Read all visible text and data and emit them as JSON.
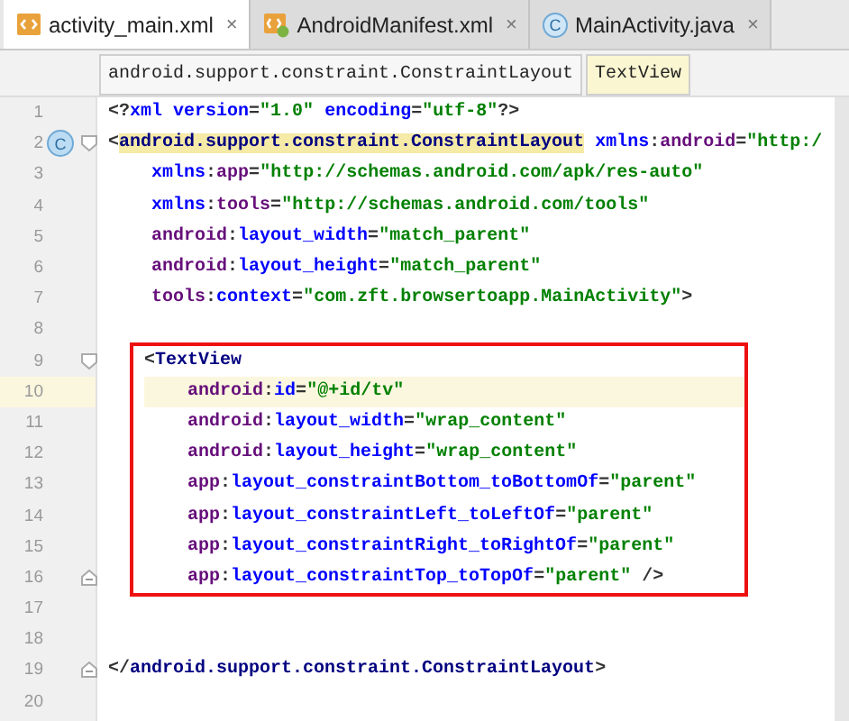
{
  "tabs": [
    {
      "label": "activity_main.xml",
      "kind": "xml",
      "selected": true,
      "close": "×"
    },
    {
      "label": "AndroidManifest.xml",
      "kind": "manifest",
      "selected": false,
      "close": "×"
    },
    {
      "label": "MainActivity.java",
      "kind": "class",
      "icon_text": "C",
      "selected": false,
      "close": "×"
    }
  ],
  "breadcrumbs": [
    {
      "label": "android.support.constraint.ConstraintLayout",
      "selected": false
    },
    {
      "label": "TextView",
      "selected": true
    }
  ],
  "line_groups": [
    {
      "boxed": false,
      "lines": [
        {
          "number": "1",
          "current": false,
          "kind": "plain",
          "tokens": [
            {
              "kind": "punct",
              "text": "<?"
            },
            {
              "kind": "attr",
              "text": "xml version"
            },
            {
              "kind": "punct",
              "text": "="
            },
            {
              "kind": "value",
              "text": "\"1.0\""
            },
            {
              "kind": "attr",
              "text": " encoding"
            },
            {
              "kind": "punct",
              "text": "="
            },
            {
              "kind": "value",
              "text": "\"utf-8\""
            },
            {
              "kind": "punct",
              "text": "?>"
            }
          ]
        },
        {
          "number": "2",
          "current": false,
          "kind": "fold-start",
          "gutter_badge": "C",
          "tokens": [
            {
              "kind": "punct",
              "text": "<"
            },
            {
              "kind": "tag-match",
              "text": "android.support.constraint.ConstraintLayout"
            },
            {
              "kind": "attr",
              "text": " xmlns"
            },
            {
              "kind": "punct",
              "text": ":"
            },
            {
              "kind": "ns",
              "text": "android"
            },
            {
              "kind": "punct",
              "text": "="
            },
            {
              "kind": "value",
              "text": "\"http:/"
            }
          ]
        },
        {
          "number": "3",
          "current": false,
          "kind": "plain",
          "tokens": [
            {
              "kind": "attr",
              "text": "    xmlns"
            },
            {
              "kind": "punct",
              "text": ":"
            },
            {
              "kind": "ns",
              "text": "app"
            },
            {
              "kind": "punct",
              "text": "="
            },
            {
              "kind": "value",
              "text": "\"http://schemas.android.com/apk/res-auto\""
            }
          ]
        },
        {
          "number": "4",
          "current": false,
          "kind": "plain",
          "tokens": [
            {
              "kind": "attr",
              "text": "    xmlns"
            },
            {
              "kind": "punct",
              "text": ":"
            },
            {
              "kind": "ns",
              "text": "tools"
            },
            {
              "kind": "punct",
              "text": "="
            },
            {
              "kind": "value",
              "text": "\"http://schemas.android.com/tools\""
            }
          ]
        },
        {
          "number": "5",
          "current": false,
          "kind": "plain",
          "tokens": [
            {
              "kind": "ns",
              "text": "    android"
            },
            {
              "kind": "punct",
              "text": ":"
            },
            {
              "kind": "attr",
              "text": "layout_width"
            },
            {
              "kind": "punct",
              "text": "="
            },
            {
              "kind": "value",
              "text": "\"match_parent\""
            }
          ]
        },
        {
          "number": "6",
          "current": false,
          "kind": "plain",
          "tokens": [
            {
              "kind": "ns",
              "text": "    android"
            },
            {
              "kind": "punct",
              "text": ":"
            },
            {
              "kind": "attr",
              "text": "layout_height"
            },
            {
              "kind": "punct",
              "text": "="
            },
            {
              "kind": "value",
              "text": "\"match_parent\""
            }
          ]
        },
        {
          "number": "7",
          "current": false,
          "kind": "plain",
          "tokens": [
            {
              "kind": "ns",
              "text": "    tools"
            },
            {
              "kind": "punct",
              "text": ":"
            },
            {
              "kind": "attr",
              "text": "context"
            },
            {
              "kind": "punct",
              "text": "="
            },
            {
              "kind": "value",
              "text": "\"com.zft.browsertoapp.MainActivity\""
            },
            {
              "kind": "punct",
              "text": ">"
            }
          ]
        },
        {
          "number": "8",
          "current": false,
          "kind": "plain"
        }
      ]
    },
    {
      "boxed": true,
      "lines": [
        {
          "number": "9",
          "current": false,
          "kind": "fold-start",
          "tokens": [
            {
              "kind": "punct",
              "text": "<"
            },
            {
              "kind": "tag",
              "text": "TextView"
            }
          ]
        },
        {
          "number": "10",
          "current": true,
          "kind": "plain",
          "tokens": [
            {
              "kind": "ns",
              "text": "    android"
            },
            {
              "kind": "punct",
              "text": ":"
            },
            {
              "kind": "attr",
              "text": "id"
            },
            {
              "kind": "punct",
              "text": "="
            },
            {
              "kind": "value",
              "text": "\"@+id/tv\""
            }
          ]
        },
        {
          "number": "11",
          "current": false,
          "kind": "plain",
          "tokens": [
            {
              "kind": "ns",
              "text": "    android"
            },
            {
              "kind": "punct",
              "text": ":"
            },
            {
              "kind": "attr",
              "text": "layout_width"
            },
            {
              "kind": "punct",
              "text": "="
            },
            {
              "kind": "value",
              "text": "\"wrap_content\""
            }
          ]
        },
        {
          "number": "12",
          "current": false,
          "kind": "plain",
          "tokens": [
            {
              "kind": "ns",
              "text": "    android"
            },
            {
              "kind": "punct",
              "text": ":"
            },
            {
              "kind": "attr",
              "text": "layout_height"
            },
            {
              "kind": "punct",
              "text": "="
            },
            {
              "kind": "value",
              "text": "\"wrap_content\""
            }
          ]
        },
        {
          "number": "13",
          "current": false,
          "kind": "plain",
          "tokens": [
            {
              "kind": "ns",
              "text": "    app"
            },
            {
              "kind": "punct",
              "text": ":"
            },
            {
              "kind": "attr",
              "text": "layout_constraintBottom_toBottomOf"
            },
            {
              "kind": "punct",
              "text": "="
            },
            {
              "kind": "value",
              "text": "\"parent\""
            }
          ]
        },
        {
          "number": "14",
          "current": false,
          "kind": "plain",
          "tokens": [
            {
              "kind": "ns",
              "text": "    app"
            },
            {
              "kind": "punct",
              "text": ":"
            },
            {
              "kind": "attr",
              "text": "layout_constraintLeft_toLeftOf"
            },
            {
              "kind": "punct",
              "text": "="
            },
            {
              "kind": "value",
              "text": "\"parent\""
            }
          ]
        },
        {
          "number": "15",
          "current": false,
          "kind": "plain",
          "tokens": [
            {
              "kind": "ns",
              "text": "    app"
            },
            {
              "kind": "punct",
              "text": ":"
            },
            {
              "kind": "attr",
              "text": "layout_constraintRight_toRightOf"
            },
            {
              "kind": "punct",
              "text": "="
            },
            {
              "kind": "value",
              "text": "\"parent\""
            }
          ]
        },
        {
          "number": "16",
          "current": false,
          "kind": "fold-end",
          "tokens": [
            {
              "kind": "ns",
              "text": "    app"
            },
            {
              "kind": "punct",
              "text": ":"
            },
            {
              "kind": "attr",
              "text": "layout_constraintTop_toTopOf"
            },
            {
              "kind": "punct",
              "text": "="
            },
            {
              "kind": "value",
              "text": "\"parent\""
            },
            {
              "kind": "punct",
              "text": " />"
            }
          ]
        }
      ]
    },
    {
      "boxed": false,
      "lines": [
        {
          "number": "17",
          "current": false,
          "kind": "plain"
        },
        {
          "number": "18",
          "current": false,
          "kind": "plain"
        },
        {
          "number": "19",
          "current": false,
          "kind": "fold-end",
          "tokens": [
            {
              "kind": "punct",
              "text": "</"
            },
            {
              "kind": "tag",
              "text": "android.support.constraint.ConstraintLayout"
            },
            {
              "kind": "punct",
              "text": ">"
            }
          ]
        },
        {
          "number": "20",
          "current": false,
          "kind": "plain"
        }
      ]
    }
  ]
}
